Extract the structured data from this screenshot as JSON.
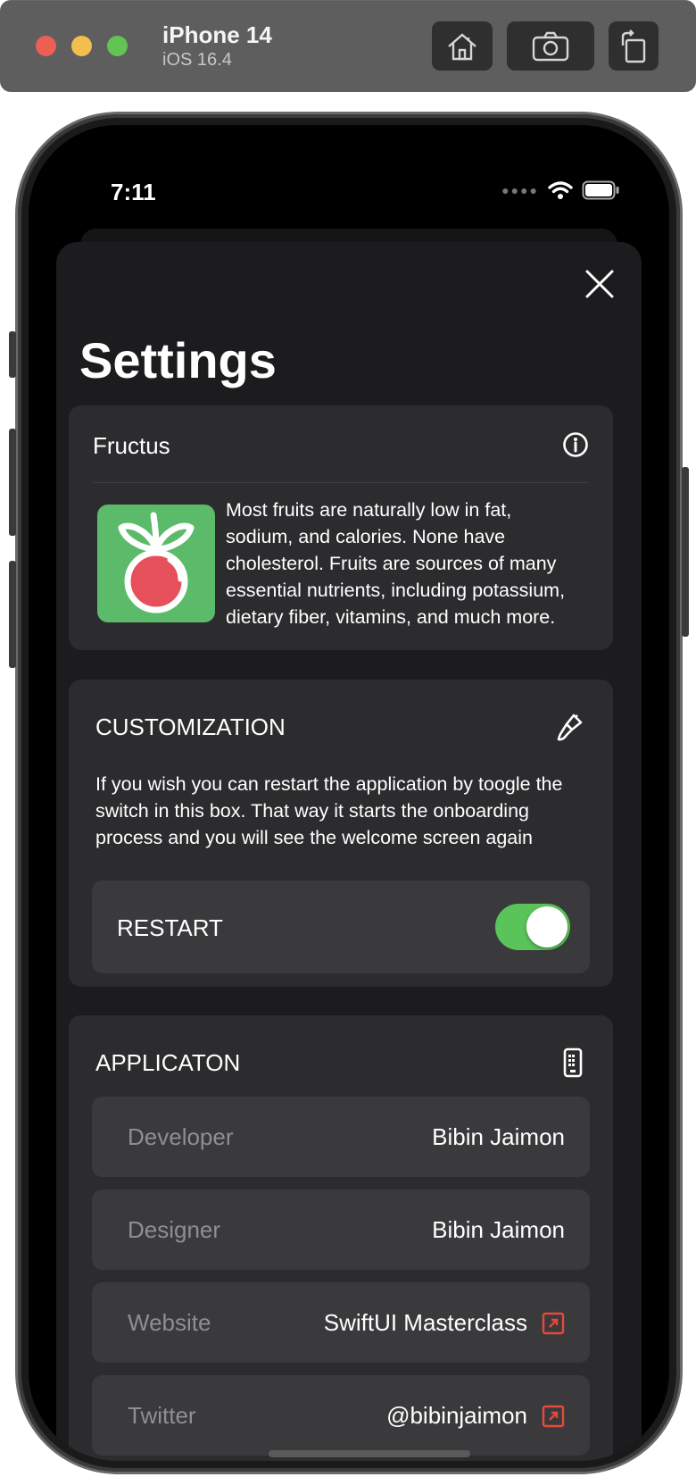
{
  "simulator": {
    "device": "iPhone 14",
    "os": "iOS 16.4",
    "buttons": [
      "home-icon",
      "screenshot-icon",
      "rotate-icon"
    ]
  },
  "status_bar": {
    "time": "7:11"
  },
  "settings": {
    "title": "Settings",
    "about": {
      "title": "Fructus",
      "icon": "info-icon",
      "description_lines": [
        "Most fruits are naturally low in fat,",
        "sodium, and calories. None have",
        "cholesterol. Fruits are sources of many",
        "essential nutrients, including potassium,",
        "dietary fiber, vitamins, and much more."
      ]
    },
    "customization": {
      "title": "CUSTOMIZATION",
      "icon": "paintbrush-icon",
      "description_lines": [
        "If you wish you can restart the application by toogle the",
        "switch in this box. That way it starts the onboarding",
        "process and you will see the welcome screen again"
      ],
      "toggle_label": "RESTART",
      "toggle_on": true
    },
    "application": {
      "title": "APPLICATON",
      "icon": "device-icon",
      "rows": [
        {
          "label": "Developer",
          "value": "Bibin Jaimon",
          "link": false
        },
        {
          "label": "Designer",
          "value": "Bibin Jaimon",
          "link": false
        },
        {
          "label": "Website",
          "value": "SwiftUI Masterclass",
          "link": true
        },
        {
          "label": "Twitter",
          "value": "@bibinjaimon",
          "link": true
        }
      ]
    }
  },
  "colors": {
    "accent_green": "#5ac45a",
    "logo_green": "#5cbb6a",
    "link_red": "#e5493a",
    "card": "#2c2c2e",
    "row": "#3a3a3c"
  }
}
